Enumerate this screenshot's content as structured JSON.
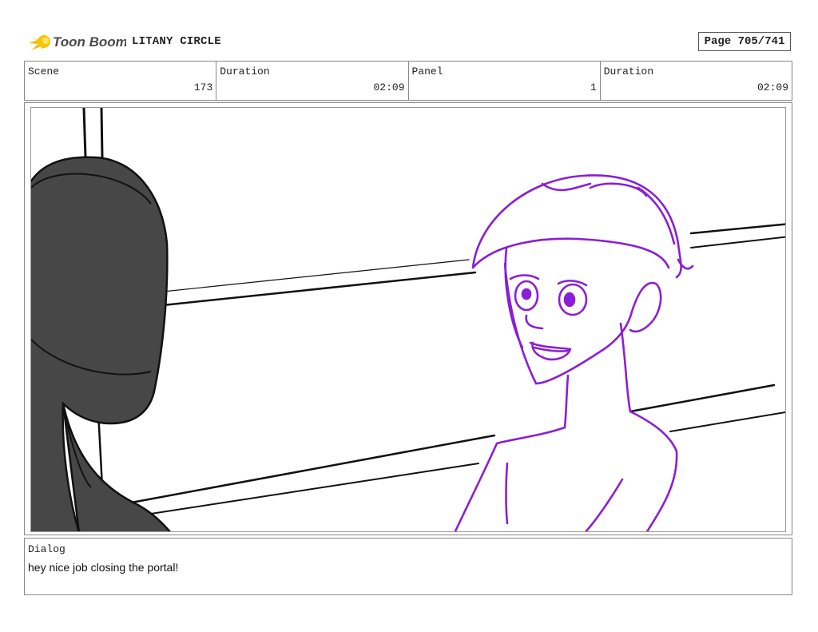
{
  "header": {
    "brand": "Toon Boom",
    "project_title": "LITANY CIRCLE",
    "page_label": "Page 705/741"
  },
  "info": {
    "scene_label": "Scene",
    "scene_value": "173",
    "duration_label": "Duration",
    "duration_value": "02:09",
    "panel_label": "Panel",
    "panel_value": "1",
    "panel_duration_label": "Duration",
    "panel_duration_value": "02:09"
  },
  "dialog": {
    "label": "Dialog",
    "text": "hey nice job closing the portal!"
  },
  "colors": {
    "sketch_purple": "#8a1fd6",
    "figure_dark": "#474747",
    "logo_yellow": "#f5b800"
  }
}
